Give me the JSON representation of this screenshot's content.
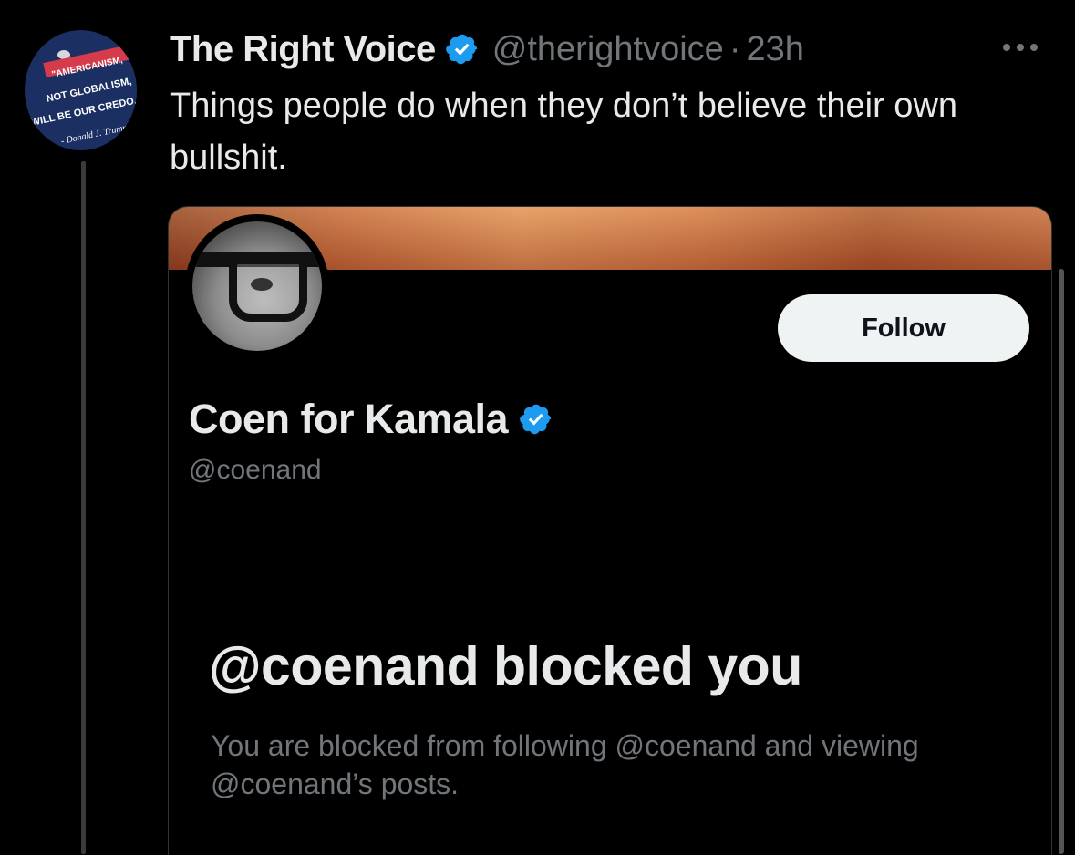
{
  "tweet": {
    "author_name": "The Right Voice",
    "handle": "@therightvoice",
    "separator": "·",
    "time": "23h",
    "text": "Things people do when they don’t believe their own bullshit.",
    "avatar_text": {
      "line1": "\"AMERICANISM,",
      "line2": "NOT GLOBALISM,",
      "line3": "WILL BE OUR CREDO.\"",
      "line4": "- Donald J. Trump"
    }
  },
  "embedded": {
    "profile_name": "Coen for Kamala",
    "profile_handle": "@coenand",
    "follow_label": "Follow",
    "blocked_title": "@coenand blocked you",
    "blocked_description": "You are blocked from following @coenand and viewing @coenand’s posts."
  },
  "colors": {
    "background": "#000000",
    "verified": "#1d9bf0",
    "muted_text": "#71767b",
    "primary_text": "#e7e9ea"
  },
  "icons": [
    "verified-badge-icon",
    "more-options-icon"
  ]
}
